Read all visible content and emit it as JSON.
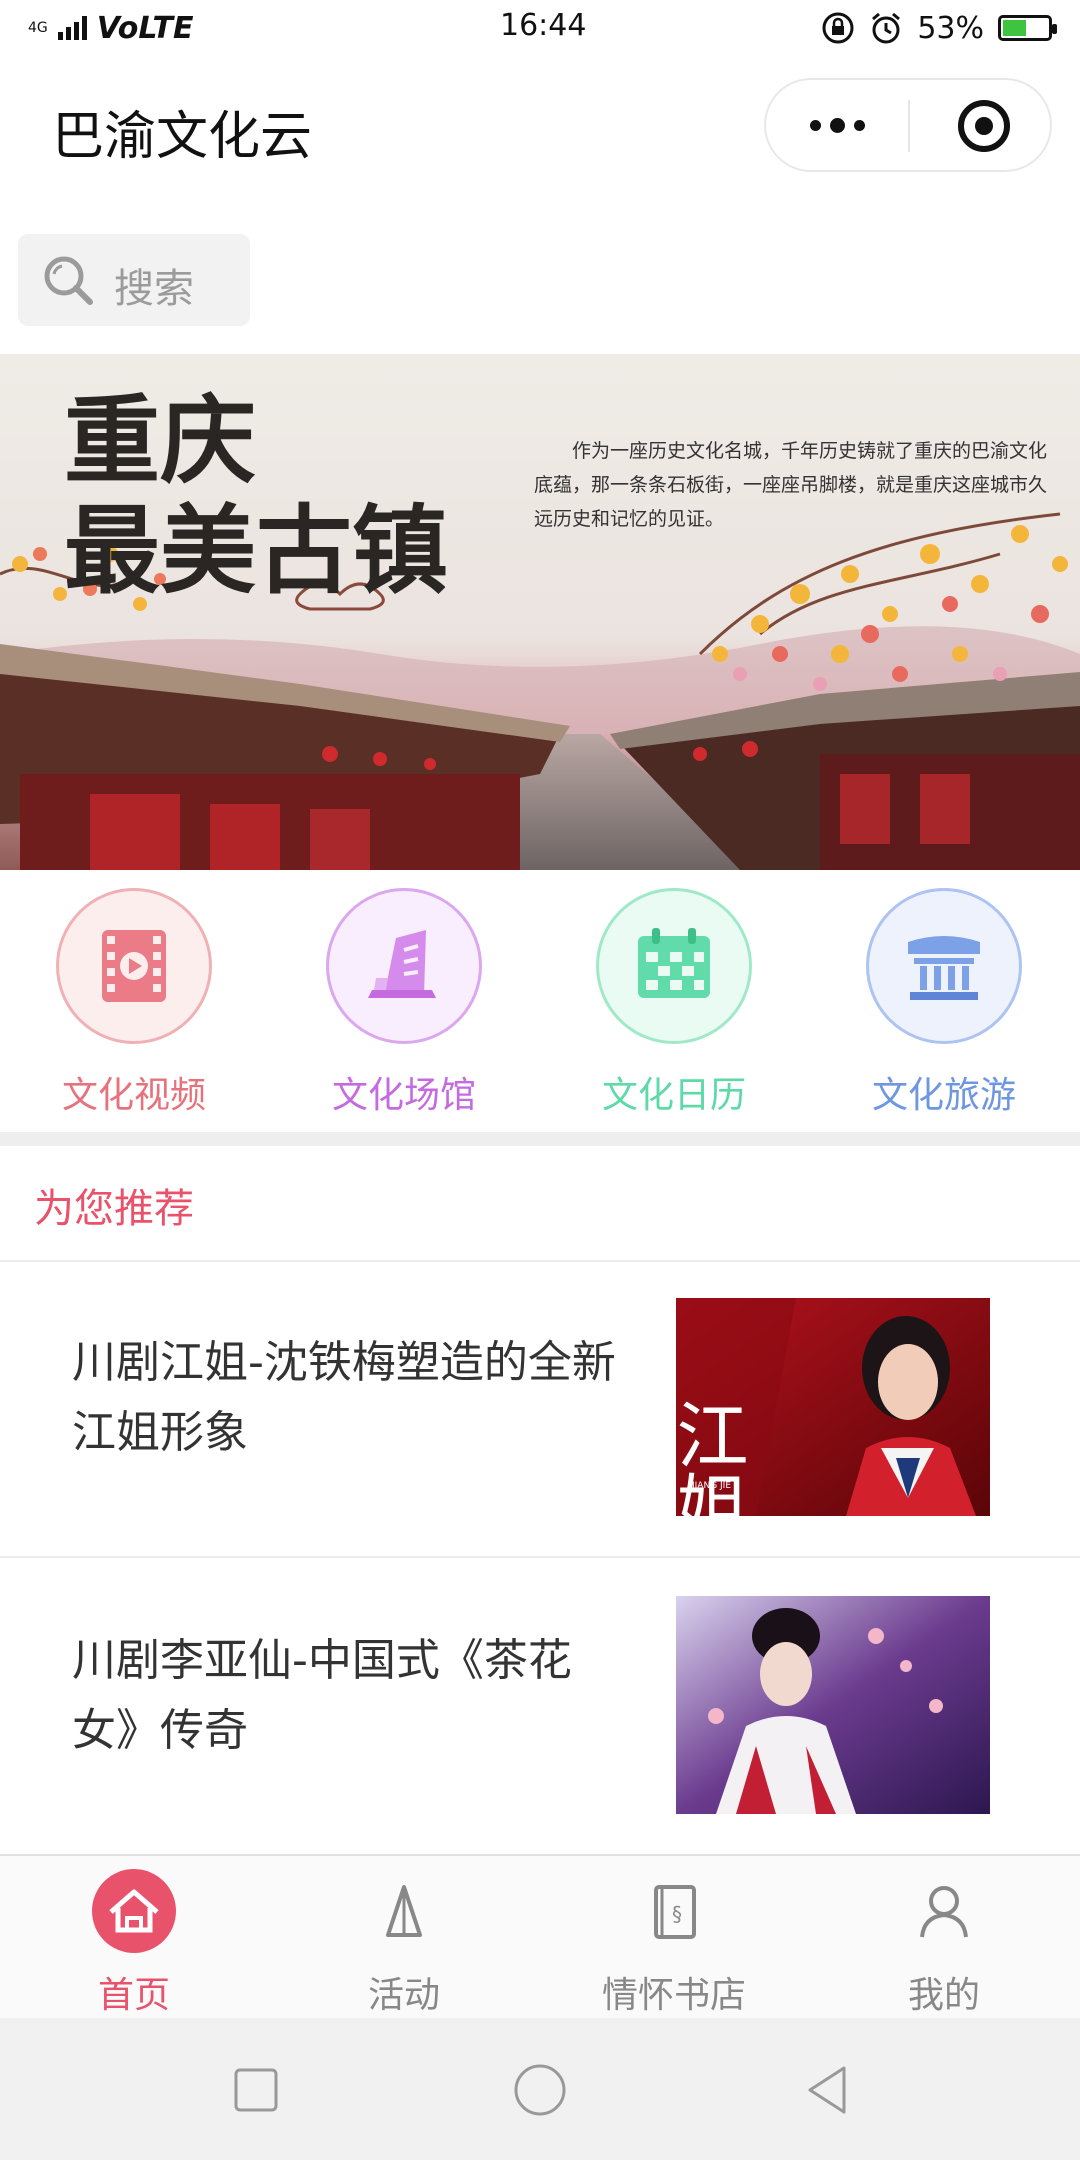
{
  "status_bar": {
    "network": "4G",
    "carrier": "VoLTE",
    "time": "16:44",
    "battery": "53%",
    "battery_level": 0.53
  },
  "header": {
    "title": "巴渝文化云",
    "more_icon": "more-dots-icon",
    "close_icon": "record-circle-icon"
  },
  "search": {
    "placeholder": "搜索",
    "icon": "search-icon"
  },
  "banner": {
    "title_line1": "重庆",
    "title_line2": "最美古镇",
    "description": "作为一座历史文化名城，千年历史铸就了重庆的巴渝文化底蕴，那一条条石板街，一座座吊脚楼，就是重庆这座城市久远历史和记忆的见证。"
  },
  "categories": [
    {
      "label": "文化视频",
      "icon": "film-play-icon",
      "color": "#e8727c"
    },
    {
      "label": "文化场馆",
      "icon": "building-icon",
      "color": "#c56be0"
    },
    {
      "label": "文化日历",
      "icon": "calendar-icon",
      "color": "#5ed9a8"
    },
    {
      "label": "文化旅游",
      "icon": "temple-icon",
      "color": "#6f96e0"
    }
  ],
  "recommend": {
    "title": "为您推荐",
    "items": [
      {
        "title": "川剧江姐-沈铁梅塑造的全新江姐形象",
        "thumb_text": "江姐",
        "thumb_sub": "JIANG JIE"
      },
      {
        "title": "川剧李亚仙-中国式《茶花女》传奇",
        "thumb_text": "",
        "thumb_sub": ""
      }
    ]
  },
  "tabbar": {
    "active_color": "#e8536b",
    "items": [
      {
        "label": "首页",
        "icon": "home-icon",
        "active": true
      },
      {
        "label": "活动",
        "icon": "activity-icon",
        "active": false
      },
      {
        "label": "情怀书店",
        "icon": "book-icon",
        "active": false
      },
      {
        "label": "我的",
        "icon": "user-icon",
        "active": false
      }
    ]
  }
}
